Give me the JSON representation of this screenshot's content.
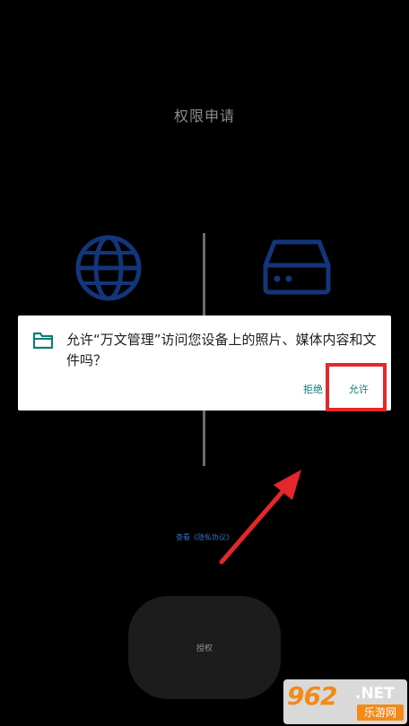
{
  "page": {
    "title": "权限申请",
    "privacy_link": "查看《隐私协议》",
    "grant_button_label": "授权"
  },
  "dialog": {
    "message": "允许“万文管理”访问您设备上的照片、媒体内容和文件吗？",
    "deny_label": "拒绝",
    "allow_label": "允许"
  },
  "watermark": {
    "logo_text": "962",
    "domain_text": ".NET",
    "site_name": "乐游网"
  },
  "colors": {
    "background": "#000000",
    "icon_blue": "#13357a",
    "dialog_accent": "#0f7c73",
    "annotation_red": "#e3272b"
  },
  "icons": [
    "globe-icon",
    "drive-icon",
    "folder-icon",
    "arrow-icon"
  ]
}
